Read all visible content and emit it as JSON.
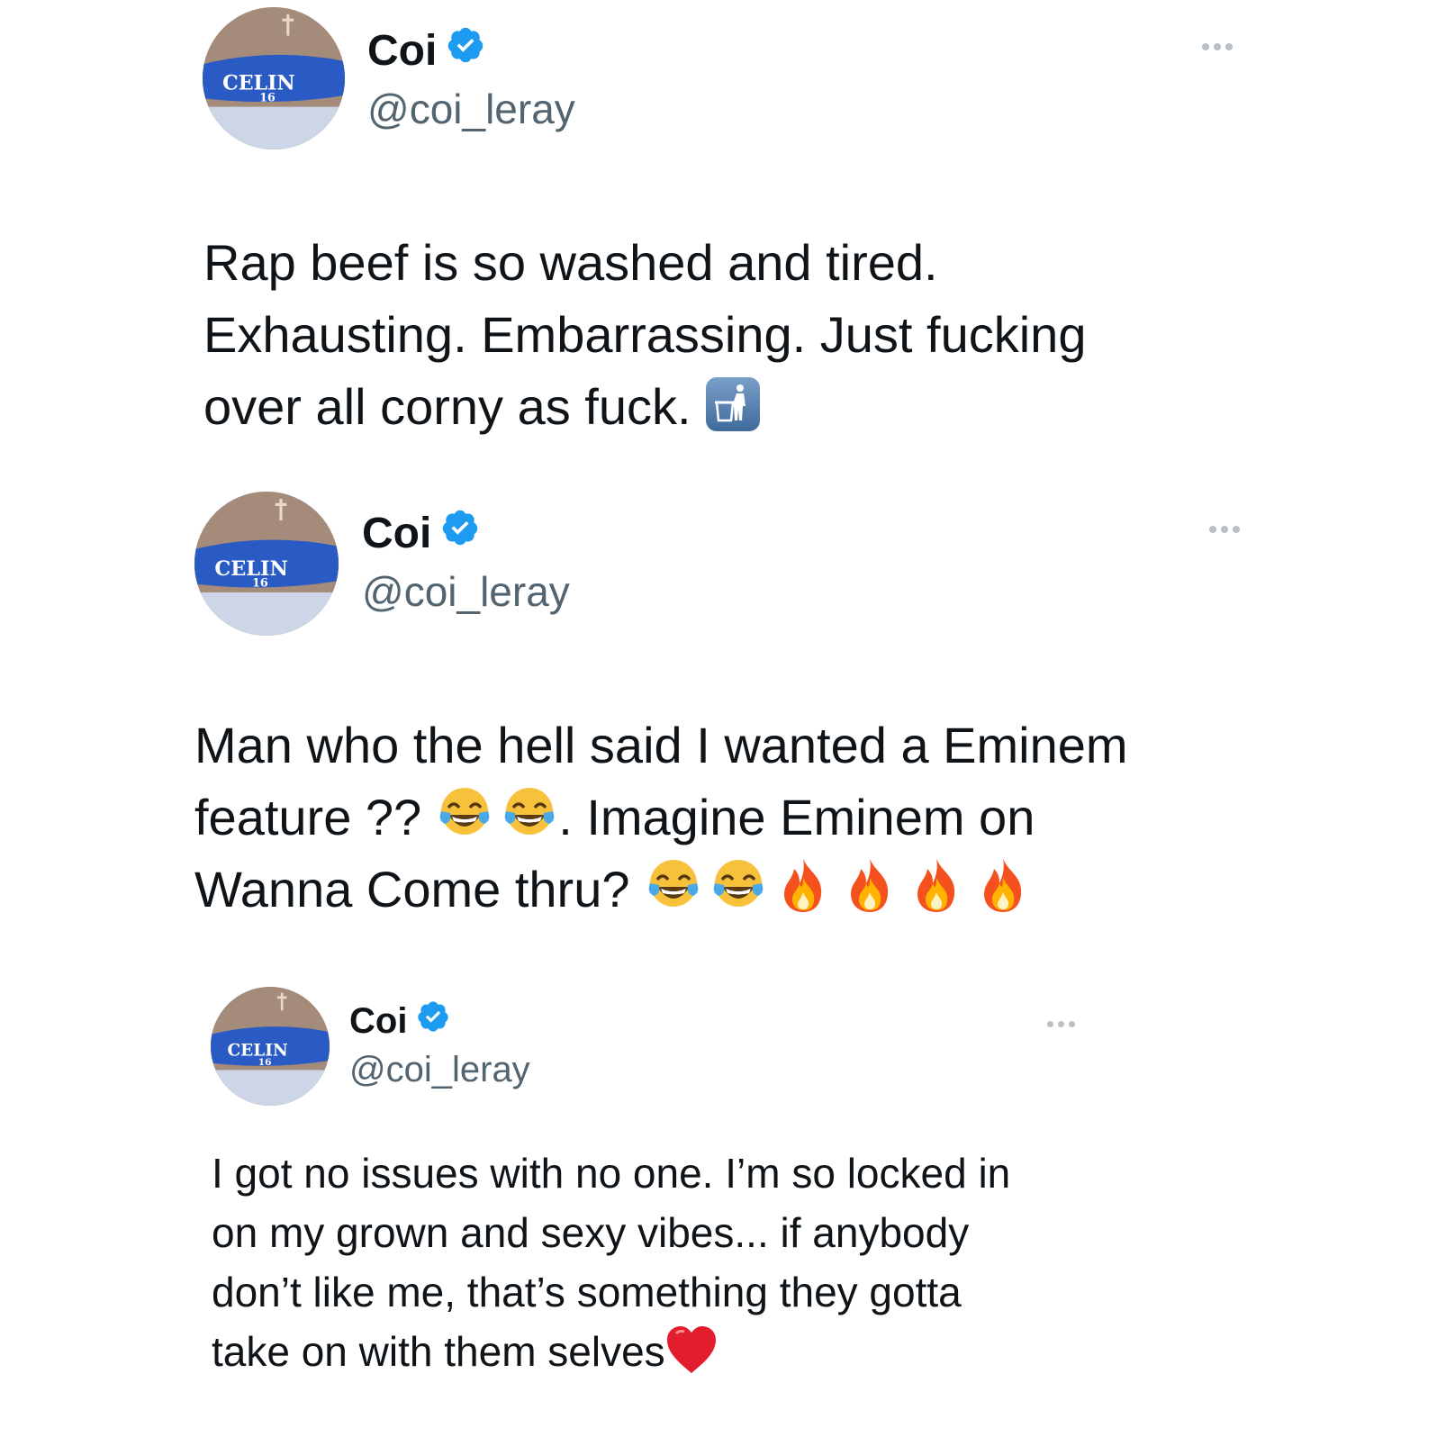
{
  "tweets": [
    {
      "author": {
        "name": "Coi",
        "handle": "@coi_leray",
        "verified": true
      },
      "lines": [
        "Rap beef is so washed and tired.",
        "Exhausting. Embarrassing. Just fucking",
        "over all corny as fuck."
      ],
      "trailing_emoji": [
        "litter-bin-icon"
      ]
    },
    {
      "author": {
        "name": "Coi",
        "handle": "@coi_leray",
        "verified": true
      },
      "lines": [
        "Man who the hell said I wanted a Eminem",
        "feature ??",
        ". Imagine Eminem on",
        "Wanna Come thru?"
      ],
      "emoji": {
        "line2": [
          "tears-of-joy-icon",
          "tears-of-joy-icon"
        ],
        "line3": [
          "tears-of-joy-icon",
          "tears-of-joy-icon",
          "fire-icon",
          "fire-icon",
          "fire-icon",
          "fire-icon"
        ]
      }
    },
    {
      "author": {
        "name": "Coi",
        "handle": "@coi_leray",
        "verified": true
      },
      "lines": [
        "I got no issues with no one. I’m so locked in",
        "on my grown and sexy vibes... if anybody",
        "don’t like me, that’s something they gotta",
        "take on with them selves"
      ],
      "trailing_emoji": [
        "red-heart-icon"
      ]
    }
  ],
  "colors": {
    "text": "#0f1419",
    "handle": "#536471",
    "verified": "#1d9bf0",
    "more_dots": "#b9c0c6"
  }
}
